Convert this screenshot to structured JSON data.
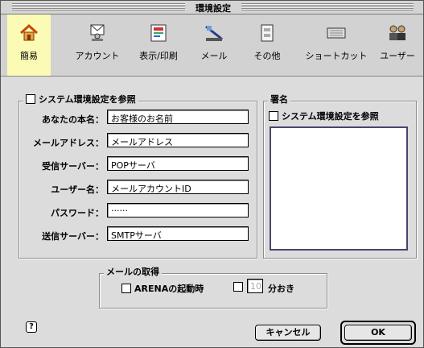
{
  "window": {
    "title": "環境設定"
  },
  "toolbar": {
    "tabs": [
      {
        "label": "簡易",
        "icon": "home-icon",
        "selected": true
      },
      {
        "label": "アカウント",
        "icon": "account-icon",
        "selected": false
      },
      {
        "label": "表示/印刷",
        "icon": "display-print-icon",
        "selected": false
      },
      {
        "label": "メール",
        "icon": "mail-icon",
        "selected": false
      },
      {
        "label": "その他",
        "icon": "other-icon",
        "selected": false
      },
      {
        "label": "ショートカット",
        "icon": "keyboard-icon",
        "selected": false
      },
      {
        "label": "ユーザー",
        "icon": "users-icon",
        "selected": false
      }
    ]
  },
  "account": {
    "system_prefs_checkbox": "システム環境設定を参照",
    "fields": [
      {
        "label": "あなたの本名：",
        "value": "お客様のお名前"
      },
      {
        "label": "メールアドレス：",
        "value": "メールアドレス"
      },
      {
        "label": "受信サーバー：",
        "value": "POPサーバ"
      },
      {
        "label": "ユーザー名：",
        "value": "メールアカウントID"
      },
      {
        "label": "パスワード：",
        "value": "······"
      },
      {
        "label": "送信サーバー：",
        "value": "SMTPサーバ"
      }
    ]
  },
  "signature": {
    "title": "署名",
    "system_prefs_checkbox": "システム環境設定を参照"
  },
  "fetch": {
    "title": "メールの取得",
    "on_launch_label": "ARENAの起動時",
    "interval_value": "10",
    "interval_unit": "分おき"
  },
  "buttons": {
    "help": "?",
    "cancel": "キャンセル",
    "ok": "OK"
  },
  "colors": {
    "selected_tab": "#fbfbb6",
    "signature_border": "#45466e"
  }
}
